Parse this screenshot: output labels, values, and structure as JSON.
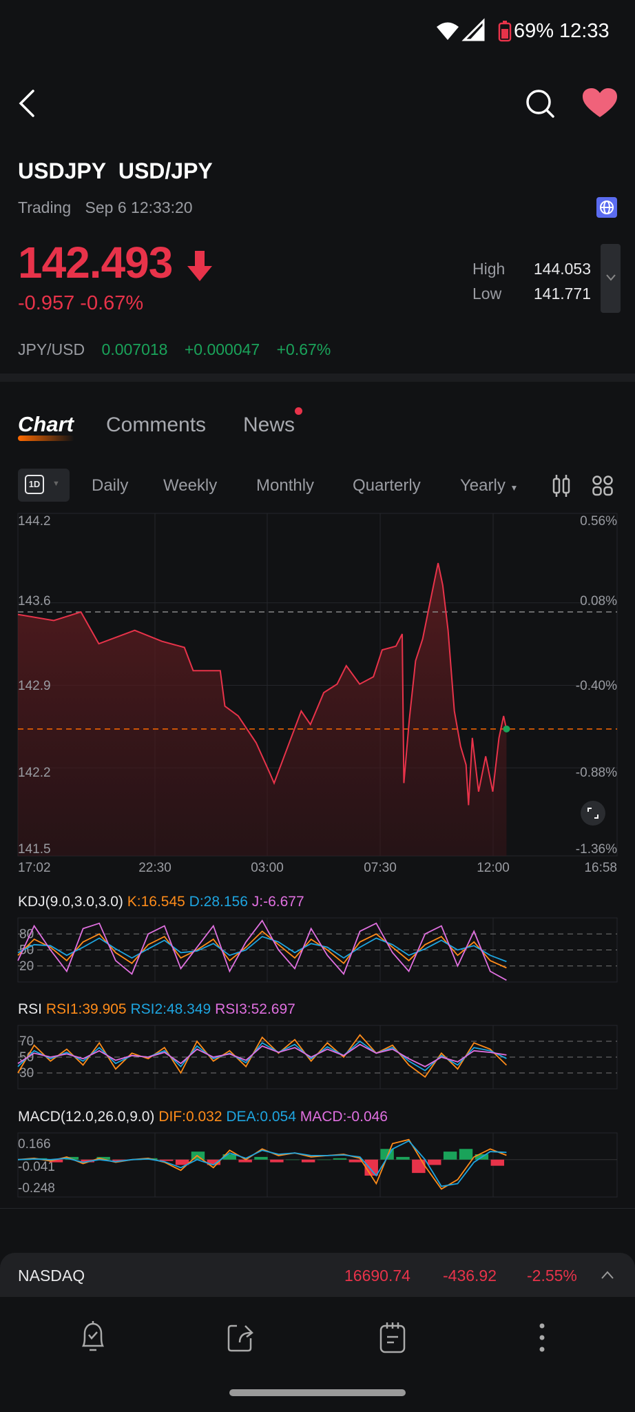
{
  "status_bar": {
    "battery": "69%",
    "time": "12:33",
    "icons": [
      "wifi-icon",
      "signal-icon",
      "battery-icon"
    ]
  },
  "header": {
    "icons": [
      "back-icon",
      "search-icon",
      "heart-icon"
    ],
    "heart_color": "#f0627a"
  },
  "quote": {
    "symbol": "USDJPY",
    "name": "USD/JPY",
    "status": "Trading",
    "timestamp": "Sep 6 12:33:20",
    "price": "142.493",
    "change": "-0.957",
    "change_pct": "-0.67%",
    "direction": "down",
    "high_label": "High",
    "high": "144.053",
    "low_label": "Low",
    "low": "141.771",
    "inverse": {
      "pair": "JPY/USD",
      "price": "0.007018",
      "change": "+0.000047",
      "change_pct": "+0.67%"
    }
  },
  "tabs": [
    {
      "label": "Chart",
      "active": true
    },
    {
      "label": "Comments"
    },
    {
      "label": "News",
      "badge": true
    }
  ],
  "periods": {
    "selected": "1D",
    "items": [
      "Daily",
      "Weekly",
      "Monthly",
      "Quarterly"
    ],
    "yearly": "Yearly"
  },
  "colors": {
    "up": "#1aa35a",
    "down": "#e8334a",
    "k": "#ff8c1a",
    "d": "#1ea5e0",
    "j": "#e070e0",
    "accent": "#ff6a00"
  },
  "chart_data": [
    {
      "type": "area",
      "ylim": [
        141.5,
        144.2
      ],
      "y_ticks": [
        "144.2",
        "143.6",
        "142.9",
        "142.2",
        "141.5"
      ],
      "y2_ticks": [
        "0.56%",
        "0.08%",
        "-0.40%",
        "-0.88%",
        "-1.36%"
      ],
      "x_ticks": [
        "17:02",
        "22:30",
        "03:00",
        "07:30",
        "12:00",
        "16:58"
      ],
      "prev_close": 143.45,
      "last": 142.493,
      "grid": true,
      "x": [
        "17:02",
        "18:28",
        "19:33",
        "20:16",
        "21:42",
        "22:47",
        "23:41",
        "00:02",
        "01:07",
        "01:18",
        "01:50",
        "02:33",
        "03:06",
        "03:16",
        "03:49",
        "04:21",
        "04:43",
        "05:15",
        "05:47",
        "06:09",
        "06:41",
        "07:14",
        "07:35",
        "08:08",
        "08:23",
        "08:27",
        "08:40",
        "08:55",
        "09:12",
        "09:34",
        "09:49",
        "10:00",
        "10:13",
        "10:28",
        "10:43",
        "10:56",
        "11:02",
        "11:11",
        "11:26",
        "11:43",
        "12:00",
        "12:15",
        "12:26",
        "12:33"
      ],
      "y": [
        143.43,
        143.38,
        143.45,
        143.19,
        143.3,
        143.21,
        143.16,
        142.97,
        142.97,
        142.68,
        142.6,
        142.38,
        142.13,
        142.05,
        142.35,
        142.64,
        142.53,
        142.79,
        142.86,
        143.01,
        142.86,
        142.92,
        143.14,
        143.17,
        143.27,
        142.05,
        142.57,
        143.05,
        143.23,
        143.6,
        143.85,
        143.67,
        143.3,
        142.64,
        142.35,
        142.2,
        141.87,
        142.42,
        141.98,
        142.27,
        141.98,
        142.42,
        142.6,
        142.49
      ]
    },
    {
      "type": "line",
      "title": "KDJ(9.0,3.0,3.0)",
      "values_text": {
        "k": "K:16.545",
        "d": "D:28.156",
        "j": "J:-6.677"
      },
      "y_ticks": [
        80,
        50,
        20
      ],
      "ylim": [
        -10,
        110
      ],
      "series": [
        {
          "name": "K",
          "values": [
            40,
            70,
            55,
            30,
            65,
            80,
            45,
            25,
            60,
            75,
            35,
            50,
            70,
            30,
            55,
            85,
            60,
            35,
            70,
            50,
            25,
            65,
            80,
            55,
            30,
            60,
            75,
            40,
            65,
            30,
            16.5
          ]
        },
        {
          "name": "D",
          "values": [
            45,
            60,
            58,
            40,
            55,
            72,
            52,
            35,
            52,
            68,
            45,
            48,
            62,
            40,
            50,
            75,
            65,
            45,
            62,
            55,
            35,
            55,
            72,
            60,
            40,
            52,
            68,
            50,
            58,
            40,
            28.2
          ]
        },
        {
          "name": "J",
          "values": [
            30,
            95,
            50,
            10,
            90,
            100,
            30,
            5,
            80,
            95,
            15,
            55,
            95,
            10,
            65,
            105,
            50,
            15,
            90,
            40,
            5,
            85,
            100,
            45,
            10,
            80,
            95,
            20,
            85,
            10,
            -6.7
          ]
        }
      ]
    },
    {
      "type": "line",
      "title": "RSI",
      "values_text": {
        "rsi1": "RSI1:39.905",
        "rsi2": "RSI2:48.349",
        "rsi3": "RSI3:52.697"
      },
      "y_ticks": [
        70,
        50,
        30
      ],
      "ylim": [
        10,
        90
      ],
      "series": [
        {
          "name": "RSI1",
          "values": [
            30,
            65,
            45,
            60,
            40,
            68,
            35,
            55,
            48,
            62,
            30,
            70,
            45,
            58,
            38,
            75,
            55,
            72,
            45,
            68,
            50,
            78,
            55,
            65,
            40,
            25,
            55,
            35,
            68,
            60,
            39.9
          ]
        },
        {
          "name": "RSI2",
          "values": [
            38,
            58,
            48,
            56,
            45,
            62,
            42,
            52,
            50,
            58,
            38,
            64,
            48,
            55,
            43,
            68,
            56,
            66,
            48,
            63,
            52,
            70,
            55,
            62,
            45,
            33,
            52,
            40,
            62,
            58,
            48.3
          ]
        },
        {
          "name": "RSI3",
          "values": [
            42,
            55,
            50,
            54,
            48,
            58,
            46,
            52,
            50,
            56,
            42,
            60,
            50,
            54,
            46,
            64,
            56,
            62,
            50,
            60,
            52,
            66,
            55,
            60,
            48,
            38,
            50,
            44,
            58,
            56,
            52.7
          ]
        }
      ]
    },
    {
      "type": "bar+line",
      "title": "MACD(12.0,26.0,9.0)",
      "values_text": {
        "dif": "DIF:0.032",
        "dea": "DEA:0.054",
        "macd": "MACD:-0.046"
      },
      "y_ticks": [
        "0.166",
        "-0.041",
        "-0.248"
      ],
      "ylim": [
        -0.28,
        0.2
      ],
      "series": [
        {
          "name": "DIF",
          "values": [
            0.0,
            0.01,
            -0.01,
            0.02,
            -0.03,
            0.01,
            -0.02,
            0.0,
            0.01,
            -0.02,
            -0.08,
            0.03,
            -0.06,
            0.07,
            0.0,
            0.08,
            0.03,
            0.05,
            0.02,
            0.03,
            0.04,
            0.01,
            -0.18,
            0.12,
            0.15,
            -0.05,
            -0.22,
            -0.15,
            0.02,
            0.08,
            0.032
          ]
        },
        {
          "name": "DEA",
          "values": [
            0.0,
            0.005,
            0.0,
            0.01,
            -0.02,
            0.0,
            -0.015,
            0.0,
            0.005,
            -0.015,
            -0.06,
            0.0,
            -0.04,
            0.05,
            0.01,
            0.07,
            0.04,
            0.05,
            0.03,
            0.03,
            0.035,
            0.02,
            -0.12,
            0.08,
            0.14,
            0.0,
            -0.2,
            -0.18,
            -0.02,
            0.06,
            0.054
          ]
        },
        {
          "name": "MACD",
          "values": [
            0.0,
            0.01,
            -0.02,
            0.02,
            -0.02,
            0.02,
            -0.01,
            0.0,
            0.01,
            -0.01,
            -0.04,
            0.06,
            -0.04,
            0.04,
            -0.02,
            0.02,
            -0.02,
            0.0,
            -0.02,
            0.0,
            0.01,
            -0.02,
            -0.12,
            0.08,
            0.02,
            -0.1,
            -0.04,
            0.06,
            0.08,
            0.04,
            -0.046
          ]
        }
      ]
    }
  ],
  "ticker_bar": {
    "name": "NASDAQ",
    "price": "16690.74",
    "change": "-436.92",
    "change_pct": "-2.55%"
  },
  "bottom_nav": {
    "icons": [
      "price-alert-icon",
      "share-icon",
      "notes-icon",
      "more-icon"
    ]
  }
}
